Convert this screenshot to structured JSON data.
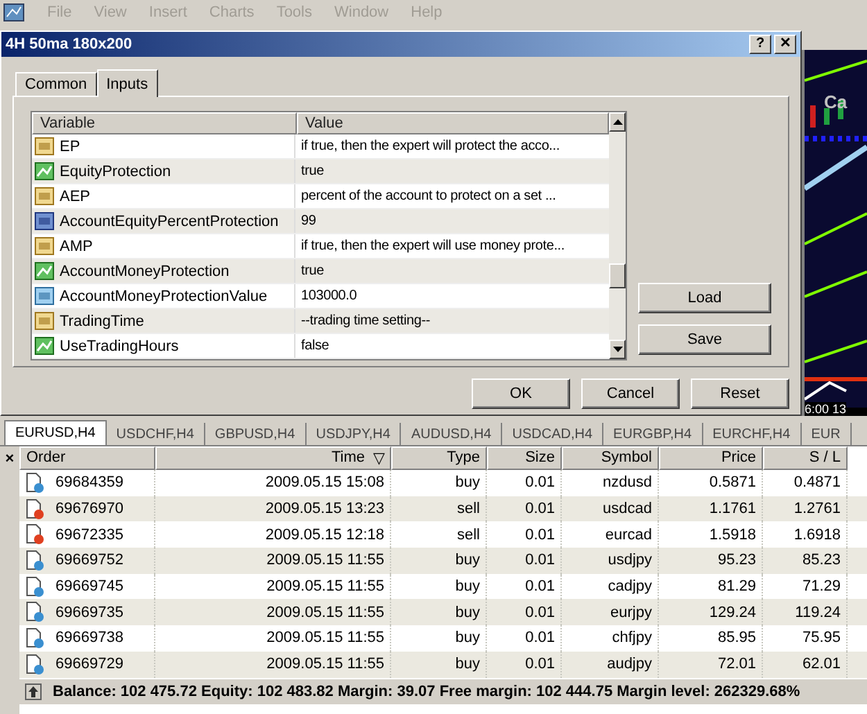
{
  "menu": [
    {
      "label": "File"
    },
    {
      "label": "View"
    },
    {
      "label": "Insert"
    },
    {
      "label": "Charts"
    },
    {
      "label": "Tools"
    },
    {
      "label": "Window"
    },
    {
      "label": "Help"
    }
  ],
  "dialog": {
    "title": "4H 50ma 180x200",
    "help_button": "?",
    "close_button": "✕",
    "tabs": [
      {
        "label": "Common",
        "selected": false
      },
      {
        "label": "Inputs",
        "selected": true
      }
    ],
    "columns": [
      "Variable",
      "Value"
    ],
    "inputs": [
      {
        "kind": "text",
        "name": "EP",
        "value": "if true, then the expert will protect the acco..."
      },
      {
        "kind": "bool",
        "name": "EquityProtection",
        "value": "true"
      },
      {
        "kind": "text",
        "name": "AEP",
        "value": "percent of the account to protect on a set ..."
      },
      {
        "kind": "int",
        "name": "AccountEquityPercentProtection",
        "value": "99"
      },
      {
        "kind": "text",
        "name": "AMP",
        "value": "if true, then the expert will use money prote..."
      },
      {
        "kind": "bool",
        "name": "AccountMoneyProtection",
        "value": "true"
      },
      {
        "kind": "double",
        "name": "AccountMoneyProtectionValue",
        "value": "103000.0"
      },
      {
        "kind": "text",
        "name": "TradingTime",
        "value": "--trading time setting--"
      },
      {
        "kind": "bool",
        "name": "UseTradingHours",
        "value": "false"
      }
    ],
    "side_buttons": [
      "Load",
      "Save"
    ],
    "buttons": [
      "OK",
      "Cancel",
      "Reset"
    ]
  },
  "chart": {
    "label": "Ca",
    "time_label": "6:00 13"
  },
  "chart_tabs": [
    {
      "label": "EURUSD,H4",
      "selected": true
    },
    {
      "label": "USDCHF,H4",
      "selected": false
    },
    {
      "label": "GBPUSD,H4",
      "selected": false
    },
    {
      "label": "USDJPY,H4",
      "selected": false
    },
    {
      "label": "AUDUSD,H4",
      "selected": false
    },
    {
      "label": "USDCAD,H4",
      "selected": false
    },
    {
      "label": "EURGBP,H4",
      "selected": false
    },
    {
      "label": "EURCHF,H4",
      "selected": false
    },
    {
      "label": "EUR",
      "selected": false
    }
  ],
  "terminal": {
    "close": "×",
    "sort_mark": "▽",
    "columns": [
      "Order",
      "Time",
      "Type",
      "Size",
      "Symbol",
      "Price",
      "S / L"
    ],
    "rows": [
      {
        "kind": "buy",
        "cells": [
          "69684359",
          "2009.05.15 15:08",
          "buy",
          "0.01",
          "nzdusd",
          "0.5871",
          "0.4871"
        ]
      },
      {
        "kind": "sell",
        "cells": [
          "69676970",
          "2009.05.15 13:23",
          "sell",
          "0.01",
          "usdcad",
          "1.1761",
          "1.2761"
        ]
      },
      {
        "kind": "sell",
        "cells": [
          "69672335",
          "2009.05.15 12:18",
          "sell",
          "0.01",
          "eurcad",
          "1.5918",
          "1.6918"
        ]
      },
      {
        "kind": "buy",
        "cells": [
          "69669752",
          "2009.05.15 11:55",
          "buy",
          "0.01",
          "usdjpy",
          "95.23",
          "85.23"
        ]
      },
      {
        "kind": "buy",
        "cells": [
          "69669745",
          "2009.05.15 11:55",
          "buy",
          "0.01",
          "cadjpy",
          "81.29",
          "71.29"
        ]
      },
      {
        "kind": "buy",
        "cells": [
          "69669735",
          "2009.05.15 11:55",
          "buy",
          "0.01",
          "eurjpy",
          "129.24",
          "119.24"
        ]
      },
      {
        "kind": "buy",
        "cells": [
          "69669738",
          "2009.05.15 11:55",
          "buy",
          "0.01",
          "chfjpy",
          "85.95",
          "75.95"
        ]
      },
      {
        "kind": "buy",
        "cells": [
          "69669729",
          "2009.05.15 11:55",
          "buy",
          "0.01",
          "audjpy",
          "72.01",
          "62.01"
        ]
      }
    ],
    "status": "Balance: 102 475.72  Equity: 102 483.82  Margin: 39.07  Free margin: 102 444.75  Margin level: 262329.68%"
  }
}
